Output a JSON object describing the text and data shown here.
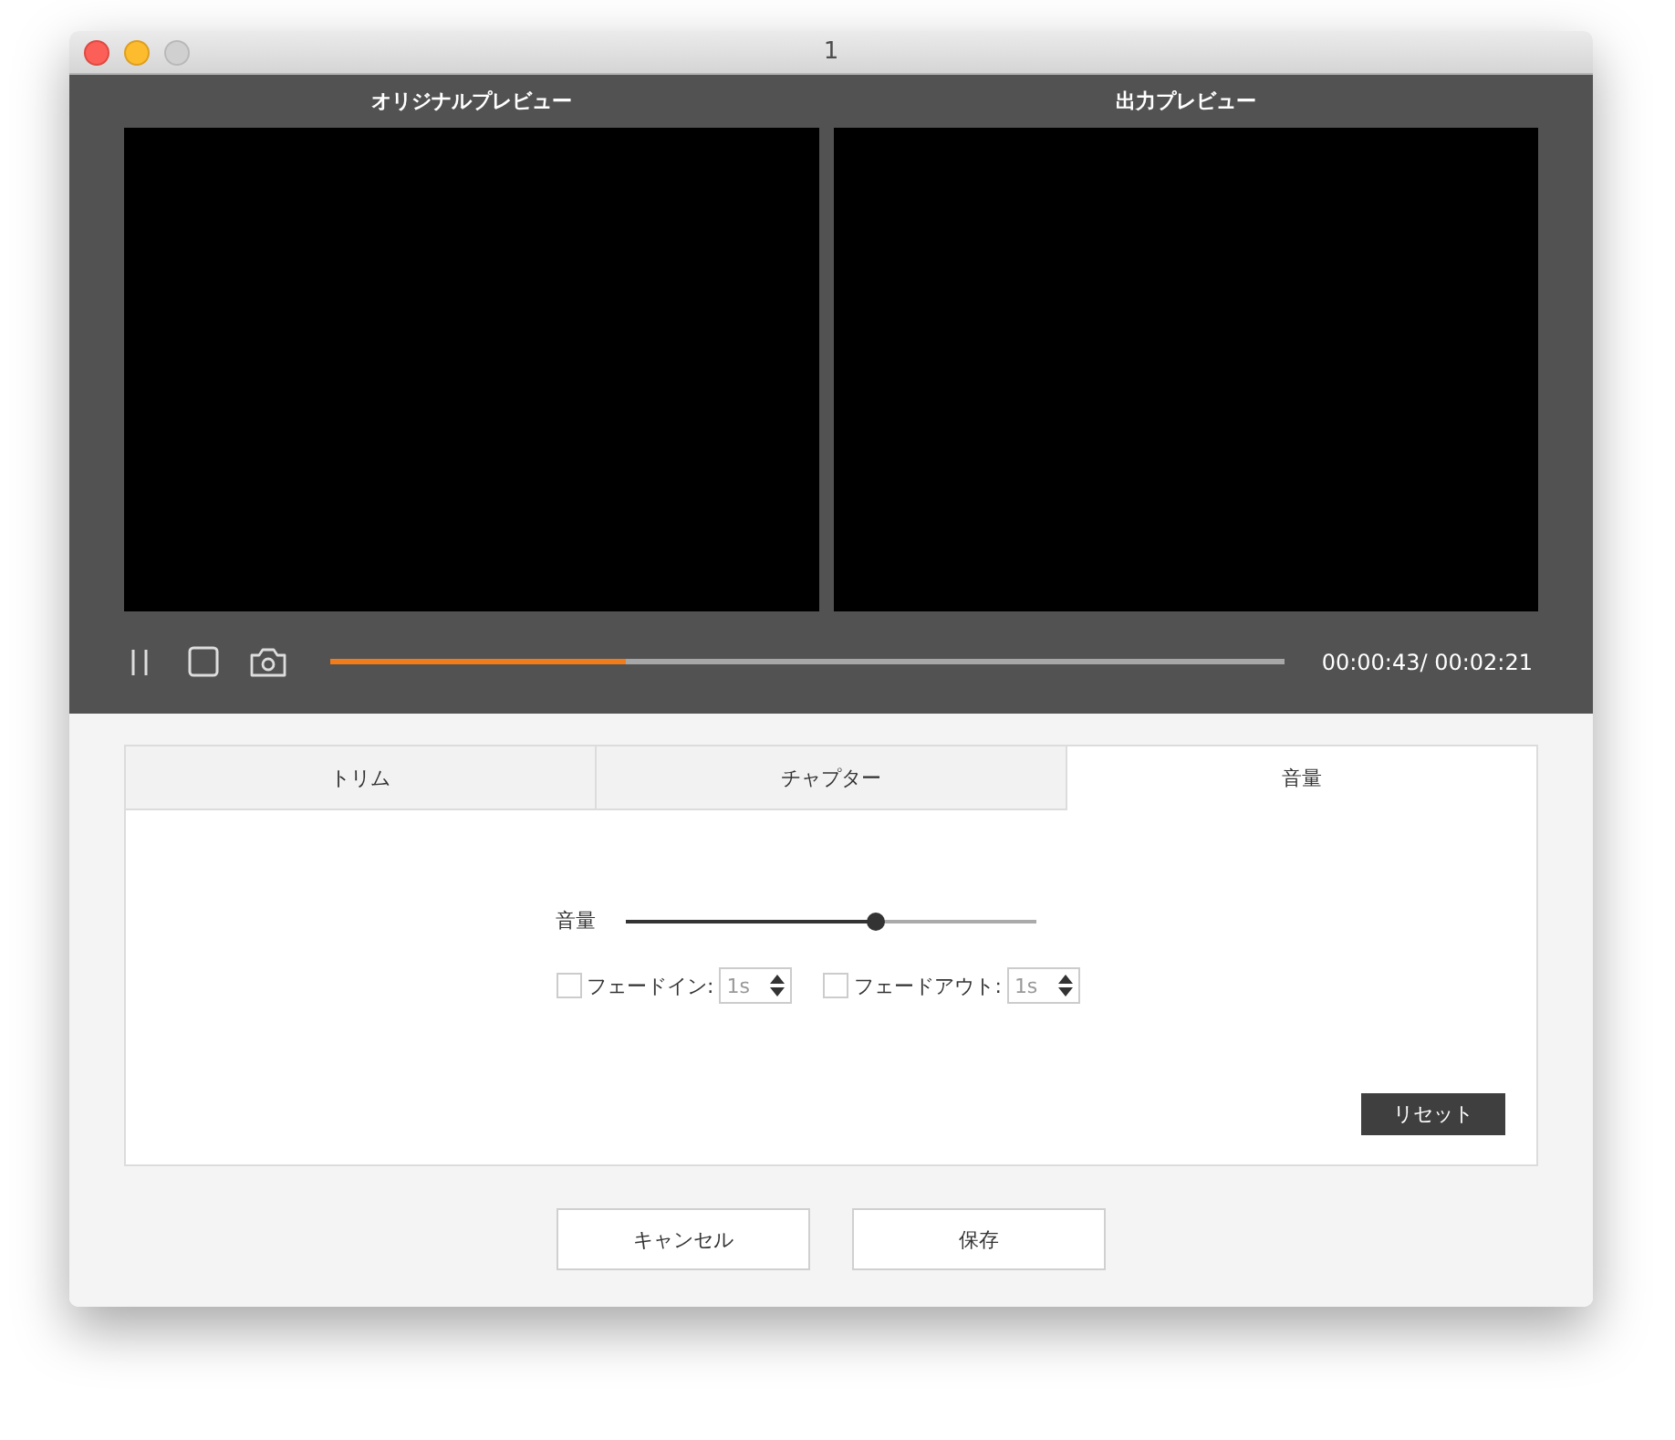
{
  "window": {
    "title": "1"
  },
  "previews": [
    {
      "label": "オリジナルプレビュー"
    },
    {
      "label": "出力プレビュー"
    }
  ],
  "player": {
    "progress": {
      "level": 0.31
    },
    "time": "00:00:43/ 00:02:21"
  },
  "tabs": [
    {
      "label": "トリム",
      "selected": false
    },
    {
      "label": "チャプター",
      "selected": false
    },
    {
      "label": "音量",
      "selected": true
    }
  ],
  "volume": {
    "label": "音量",
    "level": 0.61
  },
  "fades": [
    {
      "label": "フェードイン:",
      "checked": false,
      "value": "1s",
      "disabled": true
    },
    {
      "label": "フェードアウト:",
      "checked": false,
      "value": "1s",
      "disabled": true
    }
  ],
  "reset_button": "リセット",
  "buttons": [
    "キャンセル",
    "保存"
  ]
}
